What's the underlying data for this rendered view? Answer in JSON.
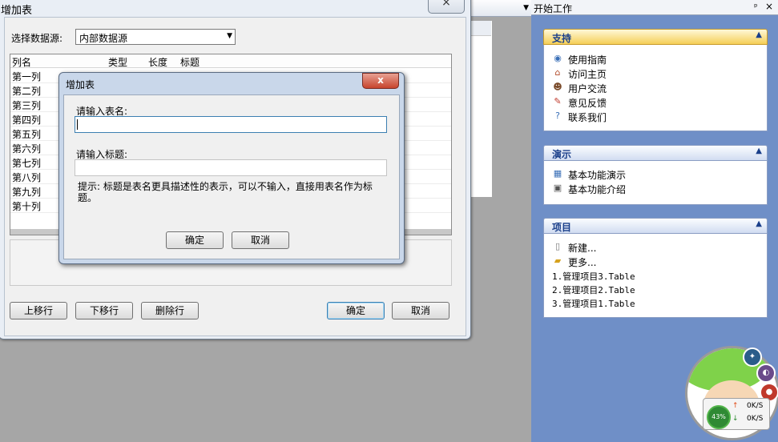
{
  "main_dialog": {
    "title": "增加表",
    "close_glyph": "×",
    "data_source_label": "选择数据源:",
    "data_source_value": "内部数据源",
    "columns_table": {
      "headers": [
        "列名",
        "类型",
        "长度",
        "标题"
      ],
      "rows": [
        "第一列",
        "第二列",
        "第三列",
        "第四列",
        "第五列",
        "第六列",
        "第七列",
        "第八列",
        "第九列",
        "第十列"
      ]
    },
    "buttons": {
      "move_up": "上移行",
      "move_down": "下移行",
      "delete_row": "删除行",
      "ok": "确定",
      "cancel": "取消"
    }
  },
  "add_table_dialog": {
    "title": "增加表",
    "close_glyph": "x",
    "table_name_label": "请输入表名:",
    "table_name_value": "",
    "caption_label": "请输入标题:",
    "caption_value": "",
    "hint": "提示: 标题是表名更具描述性的表示，可以不输入，直接用表名作为标题。",
    "ok": "确定",
    "cancel": "取消"
  },
  "task_pane": {
    "title": "开始工作",
    "pin_glyph": "ᵖ",
    "close_glyph": "×",
    "support": {
      "title": "支持",
      "items": [
        {
          "label": "使用指南",
          "icon": "guide-icon"
        },
        {
          "label": "访问主页",
          "icon": "home-icon"
        },
        {
          "label": "用户交流",
          "icon": "users-icon"
        },
        {
          "label": "意见反馈",
          "icon": "feedback-icon"
        },
        {
          "label": "联系我们",
          "icon": "contact-icon"
        }
      ]
    },
    "demo": {
      "title": "演示",
      "items": [
        {
          "label": "基本功能演示",
          "icon": "grid-icon"
        },
        {
          "label": "基本功能介绍",
          "icon": "monitor-icon"
        }
      ]
    },
    "projects": {
      "title": "项目",
      "items": [
        {
          "label": "新建...",
          "icon": "new-file-icon"
        },
        {
          "label": "更多...",
          "icon": "folder-icon"
        }
      ],
      "recent": [
        "1.管理项目3.Table",
        "2.管理项目2.Table",
        "3.管理项目1.Table"
      ]
    }
  },
  "widget": {
    "cpu_percent": "43%",
    "upload_speed": "0K/S",
    "download_speed": "0K/S",
    "up_arrow": "↑",
    "down_arrow": "↓"
  },
  "colors": {
    "pane_background": "#6f8fc7",
    "panel_title": "#1a3f8a",
    "close_red": "#c7442d",
    "selection_gold": "#f5cf57"
  }
}
